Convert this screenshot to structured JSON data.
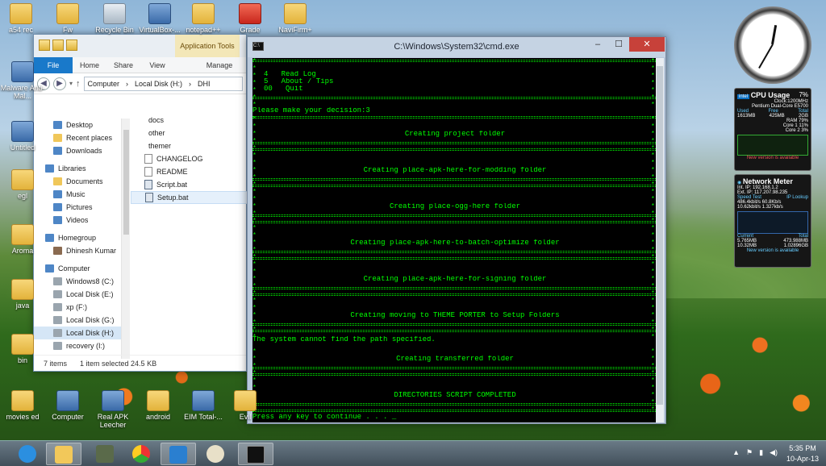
{
  "desktop": {
    "icons_top": [
      {
        "label": "a54 rec"
      },
      {
        "label": "Fw"
      },
      {
        "label": "Recycle Bin"
      },
      {
        "label": "VirtualBox-..."
      },
      {
        "label": "notepad++"
      },
      {
        "label": "Grade"
      },
      {
        "label": "NaviFirm+"
      }
    ],
    "icons_left": [
      {
        "label": "Malware Anti-Mal..."
      },
      {
        "label": "Untitled"
      },
      {
        "label": "egl"
      },
      {
        "label": "Aroma"
      },
      {
        "label": "java"
      },
      {
        "label": "bin"
      }
    ],
    "icons_bottom": [
      {
        "label": "movies ed"
      },
      {
        "label": "Computer"
      },
      {
        "label": "Real APK Leecher"
      },
      {
        "label": "android"
      },
      {
        "label": "EIM Total-..."
      },
      {
        "label": "Evil"
      }
    ]
  },
  "explorer": {
    "app_tools_label": "Application Tools",
    "tabs": [
      "File",
      "Home",
      "Share",
      "View",
      "Manage"
    ],
    "address": [
      "Computer",
      "Local Disk (H:)",
      "DHI"
    ],
    "nav": [
      {
        "label": "Desktop",
        "type": "blue"
      },
      {
        "label": "Recent places",
        "type": "fold"
      },
      {
        "label": "Downloads",
        "type": "blue"
      },
      {
        "label": "Libraries",
        "type": "head"
      },
      {
        "label": "Documents",
        "type": "fold"
      },
      {
        "label": "Music",
        "type": "blue"
      },
      {
        "label": "Pictures",
        "type": "blue"
      },
      {
        "label": "Videos",
        "type": "blue"
      },
      {
        "label": "Homegroup",
        "type": "head"
      },
      {
        "label": "Dhinesh Kumar",
        "type": "user"
      },
      {
        "label": "Computer",
        "type": "head"
      },
      {
        "label": "Windows8 (C:)",
        "type": "drive"
      },
      {
        "label": "Local Disk (E:)",
        "type": "drive"
      },
      {
        "label": "xp (F:)",
        "type": "drive"
      },
      {
        "label": "Local Disk (G:)",
        "type": "drive"
      },
      {
        "label": "Local Disk (H:)",
        "type": "drive-sel"
      },
      {
        "label": "recovery (I:)",
        "type": "drive"
      }
    ],
    "files": [
      {
        "name": "docs",
        "kind": "folder"
      },
      {
        "name": "other",
        "kind": "folder"
      },
      {
        "name": "themer",
        "kind": "folder"
      },
      {
        "name": "CHANGELOG",
        "kind": "doc"
      },
      {
        "name": "README",
        "kind": "doc"
      },
      {
        "name": "Script.bat",
        "kind": "bat"
      },
      {
        "name": "Setup.bat",
        "kind": "bat-sel"
      }
    ],
    "status_items": "7 items",
    "status_selected": "1 item selected  24.5 KB"
  },
  "cmd": {
    "title": "C:\\Windows\\System32\\cmd.exe",
    "menu_lines": [
      "4   Read Log",
      "5   About / Tips",
      "00   Quit"
    ],
    "prompt_line": "Please make your decision:3",
    "blocks": [
      "Creating project folder",
      "Creating place-apk-here-for-modding folder",
      "Creating place-ogg-here folder",
      "Creating place-apk-here-to-batch-optimize folder",
      "Creating place-apk-here-for-signing folder",
      "Creating moving to THEME PORTER to Setup Folders",
      "Creating transferred folder",
      "DIRECTORIES SCRIPT COMPLETED"
    ],
    "error_line": "The system cannot find the path specified.",
    "press_key": "Press any key to continue . . . _"
  },
  "gadgets": {
    "cpu": {
      "title": "CPU Usage",
      "percent": "7%",
      "clock": "Clock:1200MHz",
      "model": "Pentium Dual-Core E5700",
      "used_hdr": "Used",
      "free_hdr": "Free",
      "total_hdr": "Total",
      "used": "1613MB",
      "free": "425MB",
      "total": "2GB",
      "ram": "RAM 79%",
      "core1": "Core 1 11%",
      "core2": "Core 2 3%",
      "notice": "New version is available"
    },
    "net": {
      "title": "Network Meter",
      "int_ip": "Int. IP: 192.168.1.2",
      "ext_ip": "Ext. IP: 117.207.98.235",
      "speed_test": "Speed Test",
      "ip_lookup": "IP Lookup",
      "down": "486.4kbit/s  60.8Kb/s",
      "up": "10.62kbit/s  1.327kb/s",
      "current": "Current",
      "total": "Total",
      "cur_down": "5.765MB",
      "tot_down": "473.988MB",
      "cur_up": "10.32MB",
      "tot_up": "1.02896GB",
      "notice": "New version is available"
    }
  },
  "taskbar": {
    "time": "5:35 PM",
    "date": "10-Apr-13"
  },
  "colors": {
    "console_fg": "#00ff00",
    "console_bg": "#000000",
    "close_red": "#c7413a",
    "file_tab": "#1979ca"
  }
}
